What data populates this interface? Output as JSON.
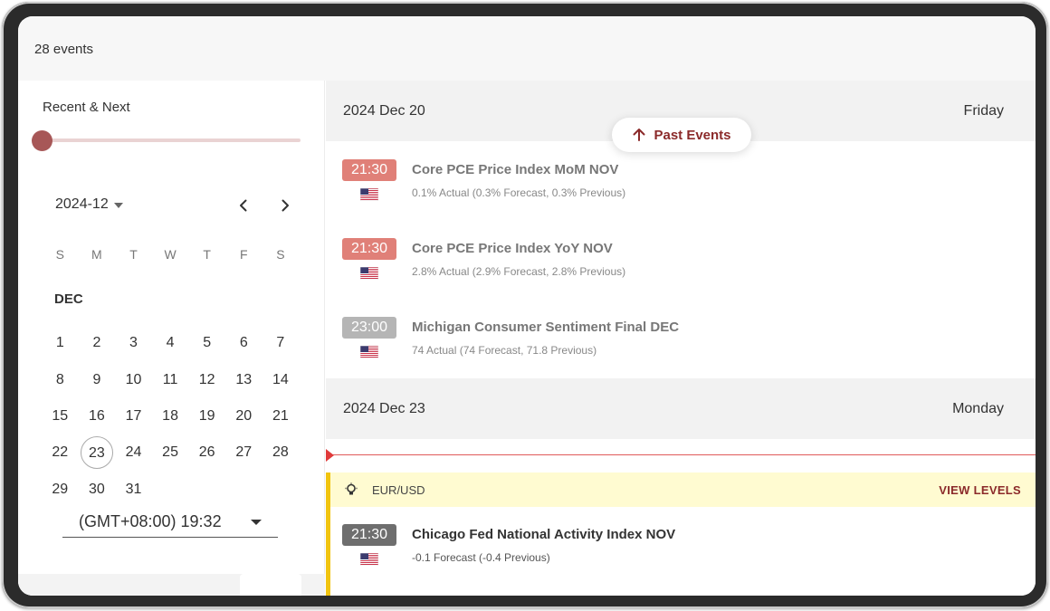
{
  "header": {
    "event_count": "28 events"
  },
  "filter": {
    "range_label": "Recent & Next",
    "slider_value": 0
  },
  "calendar": {
    "month_selector": "2024-12",
    "weekdays": [
      "S",
      "M",
      "T",
      "W",
      "T",
      "F",
      "S"
    ],
    "month_label": "DEC",
    "weeks": [
      [
        "1",
        "2",
        "3",
        "4",
        "5",
        "6",
        "7"
      ],
      [
        "8",
        "9",
        "10",
        "11",
        "12",
        "13",
        "14"
      ],
      [
        "15",
        "16",
        "17",
        "18",
        "19",
        "20",
        "21"
      ],
      [
        "22",
        "23",
        "24",
        "25",
        "26",
        "27",
        "28"
      ],
      [
        "29",
        "30",
        "31"
      ]
    ],
    "today": "23",
    "timezone": "(GMT+08:00) 19:32"
  },
  "past_events_button": "Past Events",
  "days": [
    {
      "date": "2024 Dec 20",
      "weekday": "Friday",
      "events": [
        {
          "time": "21:30",
          "time_color": "#e08078",
          "title": "Core PCE Price Index MoM NOV",
          "detail": "0.1% Actual (0.3% Forecast, 0.3% Previous)"
        },
        {
          "time": "21:30",
          "time_color": "#e08078",
          "title": "Core PCE Price Index YoY NOV",
          "detail": "2.8% Actual (2.9% Forecast, 2.8% Previous)"
        },
        {
          "time": "23:00",
          "time_color": "#b5b5b5",
          "title": "Michigan Consumer Sentiment Final DEC",
          "detail": "74 Actual (74 Forecast, 71.8 Previous)"
        }
      ]
    },
    {
      "date": "2024 Dec 23",
      "weekday": "Monday",
      "pair": {
        "name": "EUR/USD",
        "action": "VIEW LEVELS"
      },
      "events": [
        {
          "time": "21:30",
          "time_color": "#6e6e6e",
          "title": "Chicago Fed National Activity Index NOV",
          "detail": "-0.1 Forecast (-0.4 Previous)"
        }
      ]
    }
  ],
  "colors": {
    "accent": "#8b2a2a",
    "slider": "#a75757",
    "now_line": "#e05a5a",
    "pair_highlight": "#f1c40f"
  },
  "icons": {
    "flag": "us-flag-icon",
    "arrow": "arrow-up-icon",
    "bulb": "lightbulb-icon"
  }
}
